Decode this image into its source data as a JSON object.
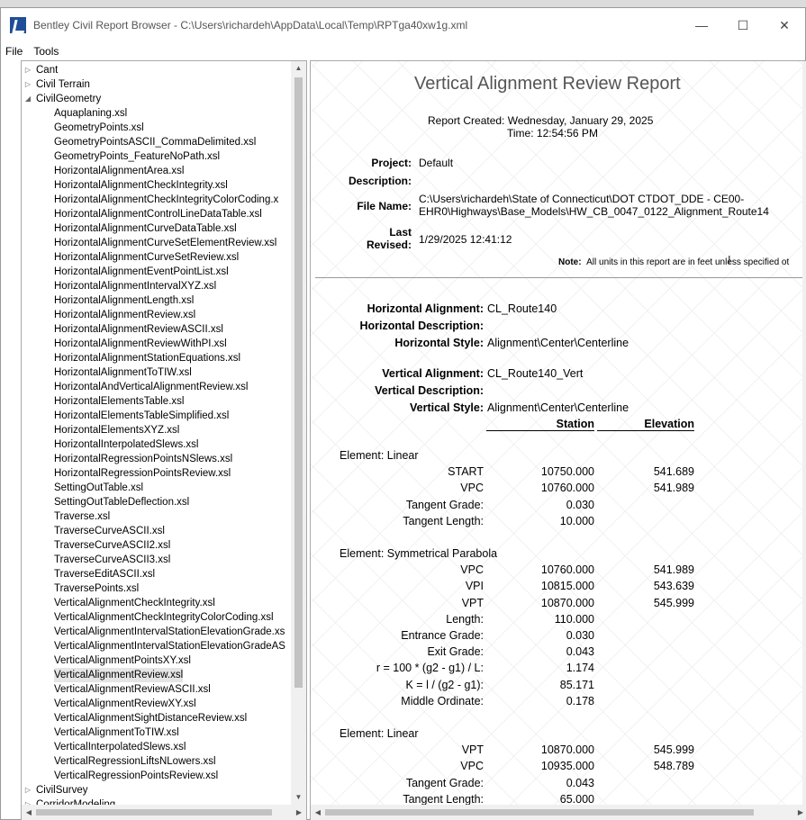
{
  "window": {
    "title": "Bentley Civil Report Browser - C:\\Users\\richardeh\\AppData\\Local\\Temp\\RPTga40xw1g.xml",
    "minimize": "—",
    "maximize": "☐",
    "close": "✕"
  },
  "menu": [
    "File",
    "Tools"
  ],
  "tree": [
    {
      "label": "Cant",
      "level": 0,
      "arrow": "▷"
    },
    {
      "label": "Civil Terrain",
      "level": 0,
      "arrow": "▷"
    },
    {
      "label": "CivilGeometry",
      "level": 0,
      "arrow": "◢"
    },
    {
      "label": "Aquaplaning.xsl",
      "level": 1
    },
    {
      "label": "GeometryPoints.xsl",
      "level": 1
    },
    {
      "label": "GeometryPointsASCII_CommaDelimited.xsl",
      "level": 1
    },
    {
      "label": "GeometryPoints_FeatureNoPath.xsl",
      "level": 1
    },
    {
      "label": "HorizontalAlignmentArea.xsl",
      "level": 1
    },
    {
      "label": "HorizontalAlignmentCheckIntegrity.xsl",
      "level": 1
    },
    {
      "label": "HorizontalAlignmentCheckIntegrityColorCoding.x",
      "level": 1
    },
    {
      "label": "HorizontalAlignmentControlLineDataTable.xsl",
      "level": 1
    },
    {
      "label": "HorizontalAlignmentCurveDataTable.xsl",
      "level": 1
    },
    {
      "label": "HorizontalAlignmentCurveSetElementReview.xsl",
      "level": 1
    },
    {
      "label": "HorizontalAlignmentCurveSetReview.xsl",
      "level": 1
    },
    {
      "label": "HorizontalAlignmentEventPointList.xsl",
      "level": 1
    },
    {
      "label": "HorizontalAlignmentIntervalXYZ.xsl",
      "level": 1
    },
    {
      "label": "HorizontalAlignmentLength.xsl",
      "level": 1
    },
    {
      "label": "HorizontalAlignmentReview.xsl",
      "level": 1
    },
    {
      "label": "HorizontalAlignmentReviewASCII.xsl",
      "level": 1
    },
    {
      "label": "HorizontalAlignmentReviewWithPI.xsl",
      "level": 1
    },
    {
      "label": "HorizontalAlignmentStationEquations.xsl",
      "level": 1
    },
    {
      "label": "HorizontalAlignmentToTIW.xsl",
      "level": 1
    },
    {
      "label": "HorizontalAndVerticalAlignmentReview.xsl",
      "level": 1
    },
    {
      "label": "HorizontalElementsTable.xsl",
      "level": 1
    },
    {
      "label": "HorizontalElementsTableSimplified.xsl",
      "level": 1
    },
    {
      "label": "HorizontalElementsXYZ.xsl",
      "level": 1
    },
    {
      "label": "HorizontalInterpolatedSlews.xsl",
      "level": 1
    },
    {
      "label": "HorizontalRegressionPointsNSlews.xsl",
      "level": 1
    },
    {
      "label": "HorizontalRegressionPointsReview.xsl",
      "level": 1
    },
    {
      "label": "SettingOutTable.xsl",
      "level": 1
    },
    {
      "label": "SettingOutTableDeflection.xsl",
      "level": 1
    },
    {
      "label": "Traverse.xsl",
      "level": 1
    },
    {
      "label": "TraverseCurveASCII.xsl",
      "level": 1
    },
    {
      "label": "TraverseCurveASCII2.xsl",
      "level": 1
    },
    {
      "label": "TraverseCurveASCII3.xsl",
      "level": 1
    },
    {
      "label": "TraverseEditASCII.xsl",
      "level": 1
    },
    {
      "label": "TraversePoints.xsl",
      "level": 1
    },
    {
      "label": "VerticalAlignmentCheckIntegrity.xsl",
      "level": 1
    },
    {
      "label": "VerticalAlignmentCheckIntegrityColorCoding.xsl",
      "level": 1
    },
    {
      "label": "VerticalAlignmentIntervalStationElevationGrade.xs",
      "level": 1
    },
    {
      "label": "VerticalAlignmentIntervalStationElevationGradeAS",
      "level": 1
    },
    {
      "label": "VerticalAlignmentPointsXY.xsl",
      "level": 1
    },
    {
      "label": "VerticalAlignmentReview.xsl",
      "level": 1,
      "selected": true
    },
    {
      "label": "VerticalAlignmentReviewASCII.xsl",
      "level": 1
    },
    {
      "label": "VerticalAlignmentReviewXY.xsl",
      "level": 1
    },
    {
      "label": "VerticalAlignmentSightDistanceReview.xsl",
      "level": 1
    },
    {
      "label": "VerticalAlignmentToTIW.xsl",
      "level": 1
    },
    {
      "label": "VerticalInterpolatedSlews.xsl",
      "level": 1
    },
    {
      "label": "VerticalRegressionLiftsNLowers.xsl",
      "level": 1
    },
    {
      "label": "VerticalRegressionPointsReview.xsl",
      "level": 1
    },
    {
      "label": "CivilSurvey",
      "level": 0,
      "arrow": "▷"
    },
    {
      "label": "CorridorModeling",
      "level": 0,
      "arrow": "▷"
    }
  ],
  "report": {
    "title": "Vertical Alignment Review Report",
    "created_line": "Report Created:  Wednesday, January 29, 2025",
    "time_line": "Time:  12:54:56 PM",
    "project_label": "Project:",
    "project_value": "Default",
    "description_label": "Description:",
    "filename_label": "File Name:",
    "filename_line1": "C:\\Users\\richardeh\\State of Connecticut\\DOT CTDOT_DDE - CE00-",
    "filename_line2": "EHR0\\Highways\\Base_Models\\HW_CB_0047_0122_Alignment_Route14",
    "last_revised_label1": "Last",
    "last_revised_label2": "Revised:",
    "last_revised_value": "1/29/2025 12:41:12",
    "note_bold": "Note:",
    "note_text": "All units in this report are in feet unless specified ot",
    "h_align_label": "Horizontal Alignment:",
    "h_align_value": "CL_Route140",
    "h_desc_label": "Horizontal Description:",
    "h_style_label": "Horizontal Style:",
    "h_style_value": "Alignment\\Center\\Centerline",
    "v_align_label": "Vertical Alignment:",
    "v_align_value": "CL_Route140_Vert",
    "v_desc_label": "Vertical Description:",
    "v_style_label": "Vertical Style:",
    "v_style_value": "Alignment\\Center\\Centerline",
    "col_station": "Station",
    "col_elevation": "Elevation",
    "elements": [
      {
        "title": "Element: Linear",
        "rows": [
          {
            "label": "START",
            "station": "10750.000",
            "elevation": "541.689"
          },
          {
            "label": "VPC",
            "station": "10760.000",
            "elevation": "541.989"
          },
          {
            "label": "Tangent Grade:",
            "station": "0.030",
            "elevation": ""
          },
          {
            "label": "Tangent Length:",
            "station": "10.000",
            "elevation": ""
          }
        ]
      },
      {
        "title": "Element: Symmetrical Parabola",
        "rows": [
          {
            "label": "VPC",
            "station": "10760.000",
            "elevation": "541.989"
          },
          {
            "label": "VPI",
            "station": "10815.000",
            "elevation": "543.639"
          },
          {
            "label": "VPT",
            "station": "10870.000",
            "elevation": "545.999"
          },
          {
            "label": "Length:",
            "station": "110.000",
            "elevation": ""
          },
          {
            "label": "Entrance Grade:",
            "station": "0.030",
            "elevation": ""
          },
          {
            "label": "Exit Grade:",
            "station": "0.043",
            "elevation": ""
          },
          {
            "label": "r = 100 * (g2 - g1) / L:",
            "station": "1.174",
            "elevation": ""
          },
          {
            "label": "K = l / (g2 - g1):",
            "station": "85.171",
            "elevation": ""
          },
          {
            "label": "Middle Ordinate:",
            "station": "0.178",
            "elevation": ""
          }
        ]
      },
      {
        "title": "Element: Linear",
        "rows": [
          {
            "label": "VPT",
            "station": "10870.000",
            "elevation": "545.999"
          },
          {
            "label": "VPC",
            "station": "10935.000",
            "elevation": "548.789"
          },
          {
            "label": "Tangent Grade:",
            "station": "0.043",
            "elevation": ""
          },
          {
            "label": "Tangent Length:",
            "station": "65.000",
            "elevation": ""
          }
        ]
      }
    ]
  }
}
